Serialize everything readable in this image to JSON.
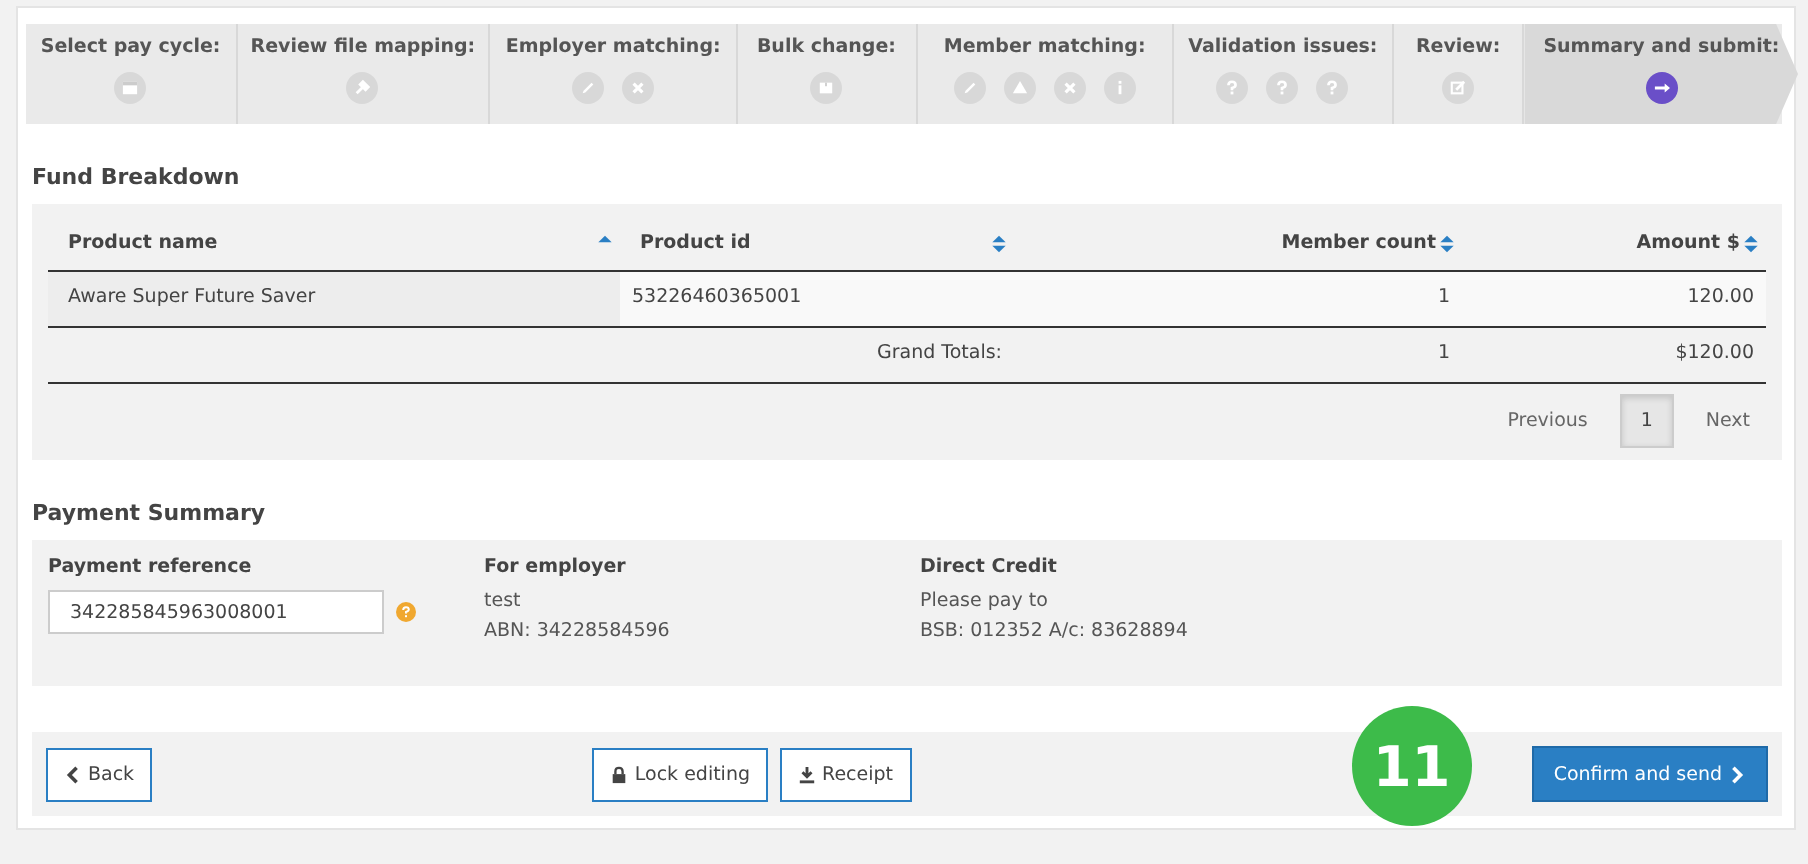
{
  "steps": [
    {
      "label": "Select pay cycle:",
      "selected": false,
      "icons": [
        {
          "kind": "calendar"
        }
      ]
    },
    {
      "label": "Review file mapping:",
      "selected": false,
      "icons": [
        {
          "kind": "plug"
        }
      ]
    },
    {
      "label": "Employer matching:",
      "selected": false,
      "icons": [
        {
          "kind": "pencil"
        },
        {
          "kind": "cross"
        }
      ]
    },
    {
      "label": "Bulk change:",
      "selected": false,
      "icons": [
        {
          "kind": "box"
        }
      ]
    },
    {
      "label": "Member matching:",
      "selected": false,
      "icons": [
        {
          "kind": "pencil"
        },
        {
          "kind": "warning"
        },
        {
          "kind": "cross"
        },
        {
          "kind": "info"
        }
      ]
    },
    {
      "label": "Validation issues:",
      "selected": false,
      "icons": [
        {
          "kind": "question"
        },
        {
          "kind": "question"
        },
        {
          "kind": "question"
        }
      ]
    },
    {
      "label": "Review:",
      "selected": false,
      "icons": [
        {
          "kind": "edit"
        }
      ]
    },
    {
      "label": "Summary and submit:",
      "selected": true,
      "icons": [
        {
          "kind": "arrow"
        }
      ]
    }
  ],
  "fund_breakdown": {
    "title": "Fund Breakdown",
    "columns": [
      {
        "label": "Product name",
        "sorted": true
      },
      {
        "label": "Product id",
        "sorted": false
      },
      {
        "label": "Member count",
        "sorted": false
      },
      {
        "label": "Amount $",
        "sorted": false
      }
    ],
    "rows": [
      [
        "Aware Super Future Saver",
        "53226460365001",
        "1",
        "120.00"
      ]
    ],
    "totals": {
      "label": "Grand Totals:",
      "member_count": "1",
      "amount": "$120.00"
    },
    "pagination": {
      "previous": "Previous",
      "pages": [
        {
          "label": "1",
          "selected": true
        }
      ],
      "next": "Next"
    }
  },
  "payment_summary": {
    "title": "Payment Summary",
    "payment_reference": {
      "label": "Payment reference",
      "value": "342285845963008001"
    },
    "employer": {
      "label": "For employer",
      "lines": [
        "test",
        "ABN: 34228584596"
      ]
    },
    "direct_credit": {
      "label": "Direct Credit",
      "lines": [
        "Please pay to",
        "BSB: 012352 A/c: 83628894"
      ]
    }
  },
  "footer": {
    "back": "Back",
    "lock": "Lock editing",
    "receipt": "Receipt",
    "confirm": "Confirm and send",
    "badge": "11"
  }
}
